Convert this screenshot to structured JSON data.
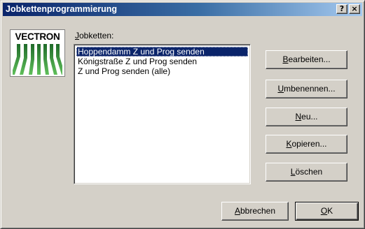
{
  "window": {
    "title": "Jobkettenprogrammierung",
    "help_button": "?",
    "close_button": "×"
  },
  "logo": {
    "text": "VECTRON",
    "icon": "vectron-logo-icon"
  },
  "joblist": {
    "label_mnemonic": "J",
    "label_rest": "obketten:",
    "items": [
      {
        "label": "Hoppendamm Z und Prog senden",
        "selected": true
      },
      {
        "label": "Königstraße Z und Prog senden",
        "selected": false
      },
      {
        "label": "Z und Prog senden (alle)",
        "selected": false
      }
    ]
  },
  "buttons": {
    "edit": {
      "mnemonic": "B",
      "rest": "earbeiten..."
    },
    "rename": {
      "mnemonic": "U",
      "rest": "mbenennen..."
    },
    "new": {
      "mnemonic": "N",
      "rest": "eu..."
    },
    "copy": {
      "mnemonic": "K",
      "rest": "opieren..."
    },
    "delete": {
      "mnemonic": "L",
      "rest": "öschen"
    },
    "cancel": {
      "mnemonic": "A",
      "rest": "bbrechen"
    },
    "ok": {
      "mnemonic": "O",
      "rest": "K"
    }
  },
  "colors": {
    "title_start": "#0a246a",
    "title_end": "#a6caf0",
    "selection": "#0a246a",
    "logo_green": "#2e8b3a"
  }
}
